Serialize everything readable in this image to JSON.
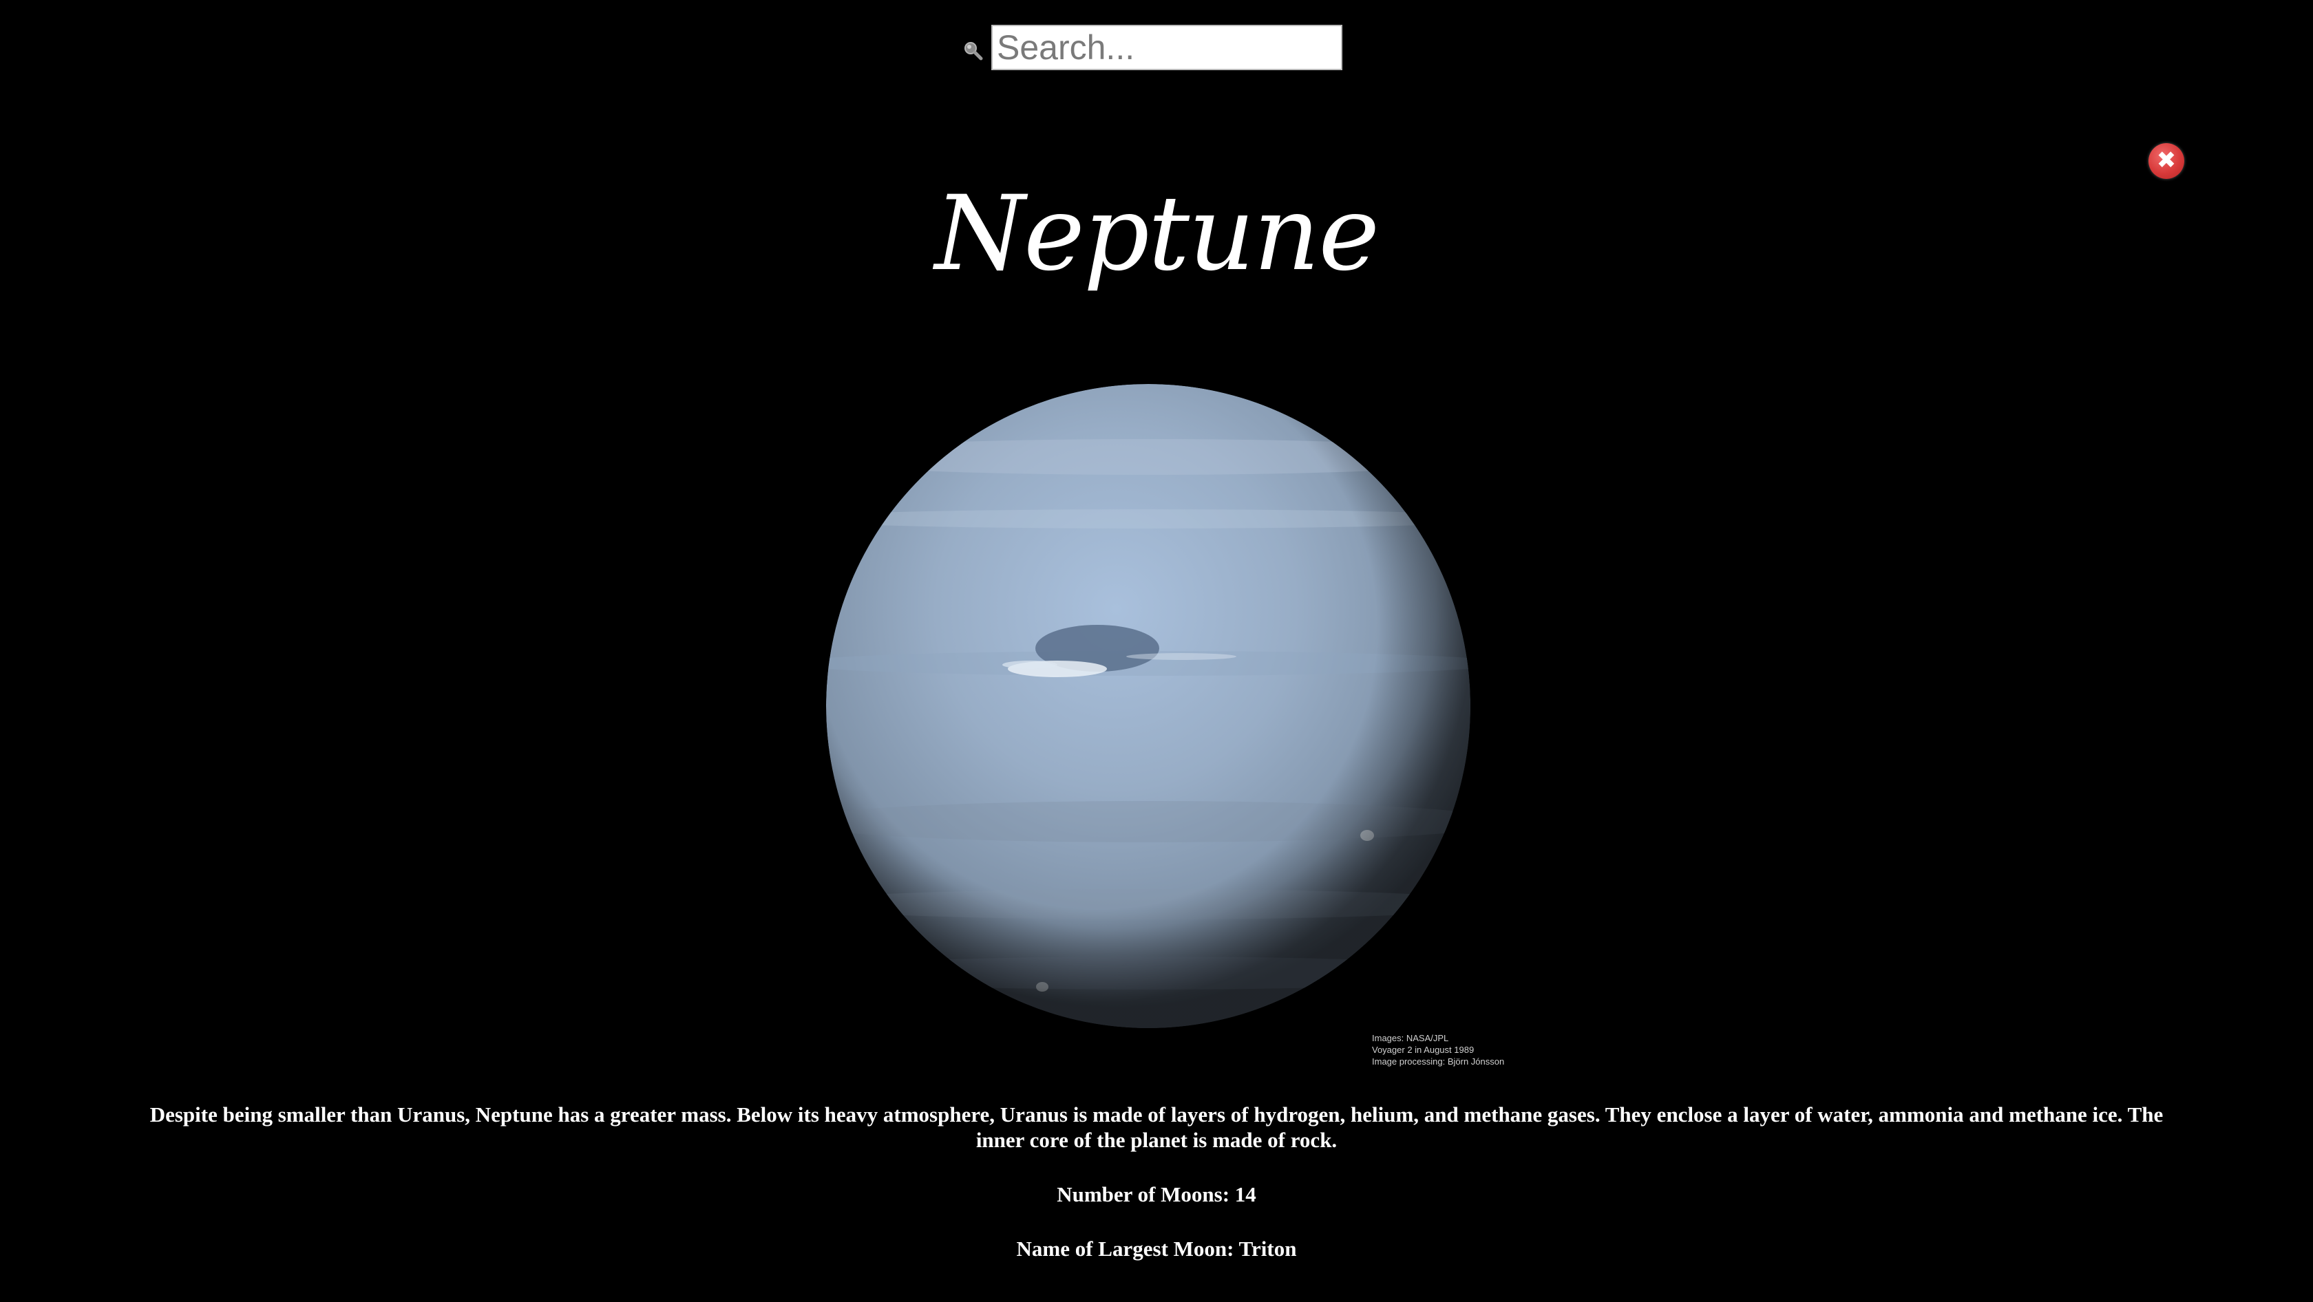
{
  "search": {
    "placeholder": "Search...",
    "value": ""
  },
  "close_button": {
    "glyph": "✖",
    "icon": "close-icon",
    "color": "#d83a3a"
  },
  "planet": {
    "name": "Neptune",
    "image_credit": [
      "Images: NASA/JPL",
      "Voyager 2 in August 1989",
      "Image processing: Björn Jónsson"
    ],
    "description": "Despite being smaller than Uranus, Neptune has a greater mass. Below its heavy atmosphere, Uranus is made of layers of hydrogen, helium, and methane gases. They enclose a layer of water, ammonia and methane ice. The inner core of the planet is made of rock.",
    "moons_text": "Number of Moons: 14",
    "largest_moon_text": "Name of Largest Moon: Triton"
  },
  "colors": {
    "background": "#000000",
    "text": "#ffffff",
    "planet_blue": "#9bb3cf"
  }
}
